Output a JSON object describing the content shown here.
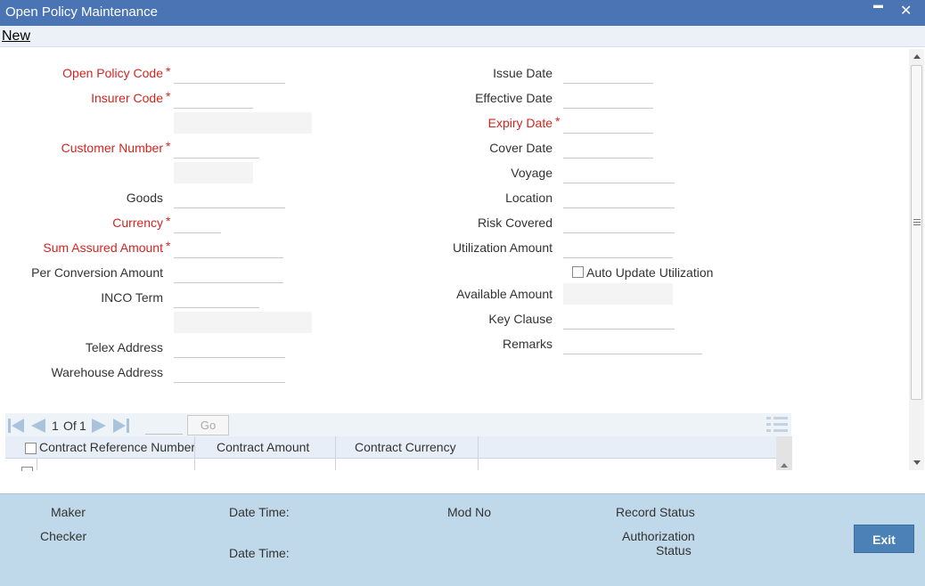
{
  "window": {
    "title": "Open Policy Maintenance",
    "minimize_glyph": "▬",
    "close_glyph": "✕"
  },
  "menu": {
    "new_label": "New"
  },
  "form": {
    "left": {
      "open_policy_code": "Open Policy Code",
      "insurer_code": "Insurer Code",
      "customer_number": "Customer Number",
      "goods": "Goods",
      "currency": "Currency",
      "sum_assured_amount": "Sum Assured Amount",
      "per_conversion_amount": "Per Conversion Amount",
      "inco_term": "INCO Term",
      "telex_address": "Telex Address",
      "warehouse_address": "Warehouse Address"
    },
    "right": {
      "issue_date": "Issue Date",
      "effective_date": "Effective Date",
      "expiry_date": "Expiry Date",
      "cover_date": "Cover Date",
      "voyage": "Voyage",
      "location": "Location",
      "risk_covered": "Risk Covered",
      "utilization_amount": "Utilization Amount",
      "auto_update_utilization": "Auto Update Utilization",
      "available_amount": "Available Amount",
      "key_clause": "Key Clause",
      "remarks": "Remarks"
    },
    "required_mark": "*"
  },
  "grid": {
    "pager": {
      "current": "1",
      "of_label": "Of",
      "total": "1",
      "go_label": "Go"
    },
    "columns": [
      "Contract Reference Number",
      "Contract Amount",
      "Contract Currency"
    ]
  },
  "footer": {
    "maker": "Maker",
    "checker": "Checker",
    "date_time_1": "Date Time:",
    "date_time_2": "Date Time:",
    "mod_no": "Mod No",
    "record_status": "Record Status",
    "authorization_status_1": "Authorization",
    "authorization_status_2": "Status",
    "exit_label": "Exit"
  },
  "colors": {
    "titlebar": "#4a74b4",
    "required": "#d42420",
    "footer": "#bfd8ea",
    "exit_button": "#4a82b7"
  }
}
